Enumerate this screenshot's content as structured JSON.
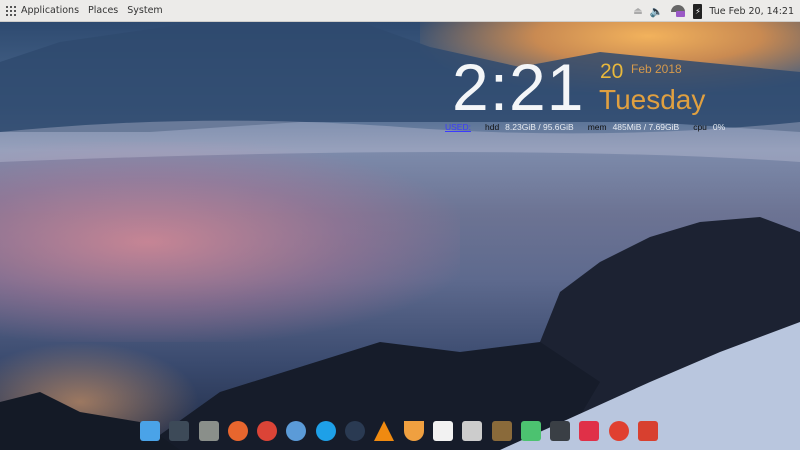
{
  "topbar": {
    "menus": [
      "Applications",
      "Places",
      "System"
    ],
    "clock": "Tue Feb 20, 14:21",
    "tray_icons": [
      "eject-icon",
      "volume-icon",
      "network-icon",
      "battery-charging-icon"
    ]
  },
  "widget": {
    "time": "2:21",
    "day": "20",
    "month_year": "Feb 2018",
    "weekday": "Tuesday",
    "used_label": "USED:",
    "hdd_label": "hdd",
    "hdd_value": "8.23GiB / 95.6GiB",
    "mem_label": "mem",
    "mem_value": "485MiB / 7.69GiB",
    "cpu_label": "cpu",
    "cpu_value": "0%"
  },
  "dock": [
    {
      "name": "show-desktop-icon",
      "color": "#4aa3e8"
    },
    {
      "name": "screenshot-icon",
      "color": "#3d4a58"
    },
    {
      "name": "file-manager-icon",
      "color": "#8a8f8a"
    },
    {
      "name": "firefox-icon",
      "color": "#e8662e"
    },
    {
      "name": "chrome-icon",
      "color": "#db4437"
    },
    {
      "name": "thunderbird-icon",
      "color": "#5b9bd8"
    },
    {
      "name": "skype-icon",
      "color": "#1ea0e8"
    },
    {
      "name": "steam-icon",
      "color": "#2a3a52"
    },
    {
      "name": "vlc-icon",
      "color": "#f08a10"
    },
    {
      "name": "mango-icon",
      "color": "#f0a040"
    },
    {
      "name": "document-icon",
      "color": "#f2f2f2"
    },
    {
      "name": "text-editor-icon",
      "color": "#cccccc"
    },
    {
      "name": "notebook-icon",
      "color": "#8a6a3a"
    },
    {
      "name": "system-monitor-icon",
      "color": "#4cc270"
    },
    {
      "name": "terminal-icon",
      "color": "#3a3f45"
    },
    {
      "name": "dice-icon",
      "color": "#e03048"
    },
    {
      "name": "search-icon",
      "color": "#e04030"
    },
    {
      "name": "trash-icon",
      "color": "#d8402f"
    }
  ]
}
